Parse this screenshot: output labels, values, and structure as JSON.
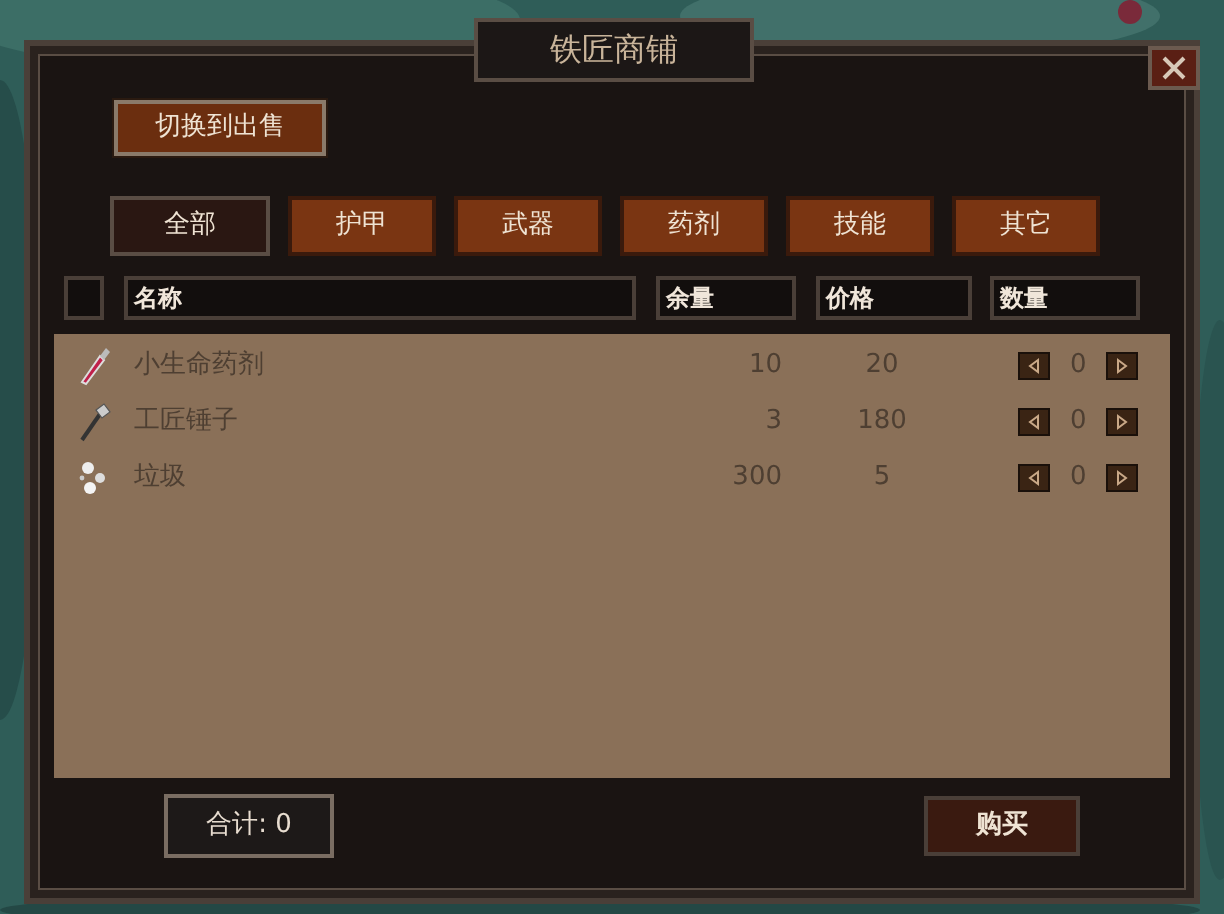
{
  "window": {
    "title": "铁匠商铺"
  },
  "mode_button": "切换到出售",
  "select_all": {
    "checked": false
  },
  "tabs": [
    {
      "label": "全部",
      "selected": true
    },
    {
      "label": "护甲",
      "selected": false
    },
    {
      "label": "武器",
      "selected": false
    },
    {
      "label": "药剂",
      "selected": false
    },
    {
      "label": "技能",
      "selected": false
    },
    {
      "label": "其它",
      "selected": false
    }
  ],
  "table": {
    "columns": [
      "名称",
      "余量",
      "价格",
      "数量"
    ],
    "rows": [
      {
        "kind": "potion",
        "name": "小生命药剂",
        "stock": "10",
        "price": "20",
        "quantity": "0"
      },
      {
        "kind": "hammer",
        "name": "工匠锤子",
        "stock": "3",
        "price": "180",
        "quantity": "0"
      },
      {
        "kind": "junk",
        "name": "垃圾",
        "stock": "300",
        "price": "5",
        "quantity": "0"
      }
    ]
  },
  "total": "合计: 0",
  "buy_button": "购买"
}
